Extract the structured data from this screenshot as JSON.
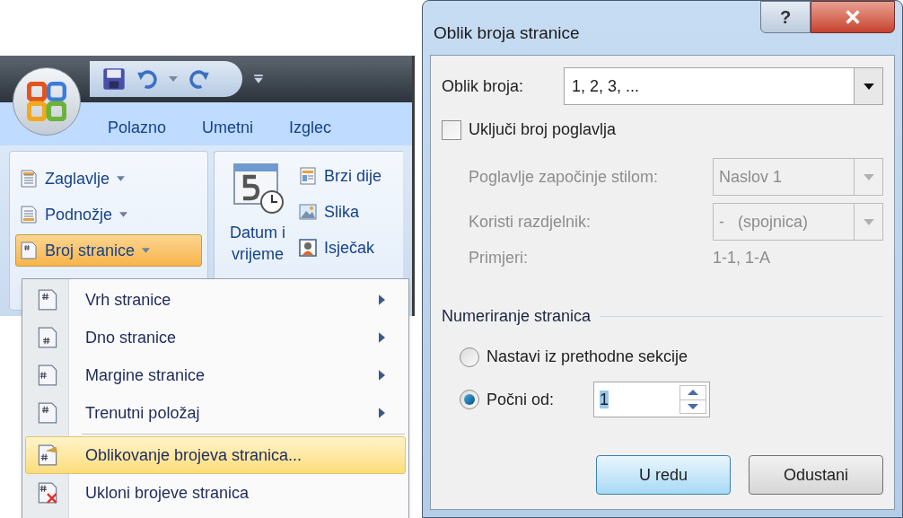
{
  "ribbon": {
    "tabs": [
      {
        "label": "Polazno"
      },
      {
        "label": "Umetni"
      },
      {
        "label": "Izglec"
      }
    ],
    "header_footer": [
      {
        "label": "Zaglavlje",
        "kind": "header",
        "pressed": false
      },
      {
        "label": "Podnožje",
        "kind": "footer",
        "pressed": false
      },
      {
        "label": "Broj stranice",
        "kind": "pagenum",
        "pressed": true
      }
    ],
    "date_button": {
      "label": "Datum i vrijeme"
    },
    "insert_items": [
      {
        "label": "Brzi dije",
        "kind": "parts"
      },
      {
        "label": "Slika",
        "kind": "image"
      },
      {
        "label": "Isječak",
        "kind": "clipart"
      }
    ]
  },
  "menu": {
    "items": [
      {
        "label": "Vrh stranice",
        "kind": "top",
        "submenu": true,
        "selected": false,
        "separator_before": false
      },
      {
        "label": "Dno stranice",
        "kind": "bottom",
        "submenu": true,
        "selected": false,
        "separator_before": false
      },
      {
        "label": "Margine stranice",
        "kind": "margin",
        "submenu": true,
        "selected": false,
        "separator_before": false
      },
      {
        "label": "Trenutni položaj",
        "kind": "current",
        "submenu": true,
        "selected": false,
        "separator_before": false
      },
      {
        "label": "Oblikovanje brojeva stranica...",
        "kind": "format",
        "submenu": false,
        "selected": true,
        "separator_before": true
      },
      {
        "label": "Ukloni brojeve stranica",
        "kind": "remove",
        "submenu": false,
        "selected": false,
        "separator_before": false
      }
    ]
  },
  "dialog": {
    "title": "Oblik broja stranice",
    "help_button": "?",
    "number_format": {
      "label": "Oblik broja:",
      "value": "1, 2, 3, ..."
    },
    "include_chapter": {
      "label": "Uključi broj poglavlja",
      "checked": false
    },
    "chapter_style": {
      "label": "Poglavlje započinje stilom:",
      "value": "Naslov 1",
      "disabled": true
    },
    "separator": {
      "label": "Koristi razdjelnik:",
      "value": "-   (spojnica)",
      "disabled": true
    },
    "examples": {
      "label": "Primjeri:",
      "value": "1-1, 1-A",
      "disabled": true
    },
    "numbering": {
      "title": "Numeriranje stranica",
      "options": [
        {
          "label": "Nastavi iz prethodne sekcije",
          "selected": false
        },
        {
          "label": "Počni od:",
          "selected": true
        }
      ],
      "start_at": "1"
    },
    "buttons": [
      {
        "label": "U redu",
        "default": true
      },
      {
        "label": "Odustani",
        "default": false
      }
    ]
  }
}
